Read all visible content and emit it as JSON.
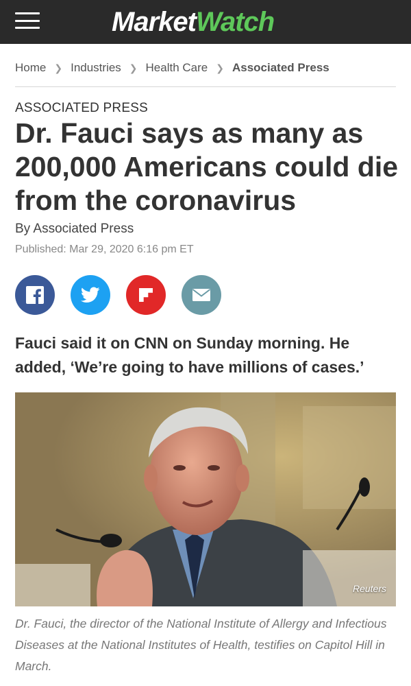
{
  "header": {
    "logo_part1": "Market",
    "logo_part2": "Watch",
    "menu_icon": "hamburger-menu-icon",
    "colors": {
      "bar": "#2a2a2a",
      "logo_accent": "#5ec85a"
    }
  },
  "breadcrumb": {
    "items": [
      "Home",
      "Industries",
      "Health Care",
      "Associated Press"
    ],
    "separator_icon": "chevron-right-icon"
  },
  "article": {
    "kicker": "ASSOCIATED PRESS",
    "headline": "Dr. Fauci says as many as 200,000 Americans could die from the coronavirus",
    "byline": "By Associated Press",
    "published": "Published: Mar 29, 2020 6:16 pm ET",
    "dek": "Fauci said it on CNN on Sunday morning. He added, ‘We’re going to have millions of cases.’",
    "share": [
      {
        "name": "facebook",
        "icon": "facebook-icon",
        "color": "#3b5998"
      },
      {
        "name": "twitter",
        "icon": "twitter-icon",
        "color": "#1da1f2"
      },
      {
        "name": "flipboard",
        "icon": "flipboard-icon",
        "color": "#e12828"
      },
      {
        "name": "email",
        "icon": "email-icon",
        "color": "#6a9ba6"
      }
    ],
    "photo": {
      "credit": "Reuters",
      "caption": "Dr. Fauci, the director of the National Institute of Allergy and Infectious Diseases at the National Institutes of Health, testifies on Capitol Hill in March."
    }
  }
}
